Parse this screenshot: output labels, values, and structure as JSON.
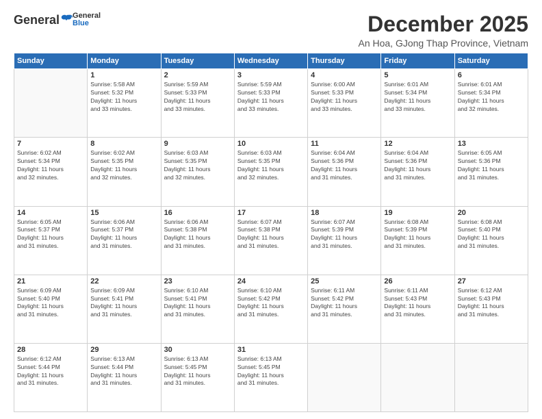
{
  "logo": {
    "general": "General",
    "blue": "Blue"
  },
  "title": "December 2025",
  "location": "An Hoa, GJong Thap Province, Vietnam",
  "weekdays": [
    "Sunday",
    "Monday",
    "Tuesday",
    "Wednesday",
    "Thursday",
    "Friday",
    "Saturday"
  ],
  "weeks": [
    [
      {
        "day": "",
        "info": ""
      },
      {
        "day": "1",
        "info": "Sunrise: 5:58 AM\nSunset: 5:32 PM\nDaylight: 11 hours\nand 33 minutes."
      },
      {
        "day": "2",
        "info": "Sunrise: 5:59 AM\nSunset: 5:33 PM\nDaylight: 11 hours\nand 33 minutes."
      },
      {
        "day": "3",
        "info": "Sunrise: 5:59 AM\nSunset: 5:33 PM\nDaylight: 11 hours\nand 33 minutes."
      },
      {
        "day": "4",
        "info": "Sunrise: 6:00 AM\nSunset: 5:33 PM\nDaylight: 11 hours\nand 33 minutes."
      },
      {
        "day": "5",
        "info": "Sunrise: 6:01 AM\nSunset: 5:34 PM\nDaylight: 11 hours\nand 33 minutes."
      },
      {
        "day": "6",
        "info": "Sunrise: 6:01 AM\nSunset: 5:34 PM\nDaylight: 11 hours\nand 32 minutes."
      }
    ],
    [
      {
        "day": "7",
        "info": "Sunrise: 6:02 AM\nSunset: 5:34 PM\nDaylight: 11 hours\nand 32 minutes."
      },
      {
        "day": "8",
        "info": "Sunrise: 6:02 AM\nSunset: 5:35 PM\nDaylight: 11 hours\nand 32 minutes."
      },
      {
        "day": "9",
        "info": "Sunrise: 6:03 AM\nSunset: 5:35 PM\nDaylight: 11 hours\nand 32 minutes."
      },
      {
        "day": "10",
        "info": "Sunrise: 6:03 AM\nSunset: 5:35 PM\nDaylight: 11 hours\nand 32 minutes."
      },
      {
        "day": "11",
        "info": "Sunrise: 6:04 AM\nSunset: 5:36 PM\nDaylight: 11 hours\nand 31 minutes."
      },
      {
        "day": "12",
        "info": "Sunrise: 6:04 AM\nSunset: 5:36 PM\nDaylight: 11 hours\nand 31 minutes."
      },
      {
        "day": "13",
        "info": "Sunrise: 6:05 AM\nSunset: 5:36 PM\nDaylight: 11 hours\nand 31 minutes."
      }
    ],
    [
      {
        "day": "14",
        "info": "Sunrise: 6:05 AM\nSunset: 5:37 PM\nDaylight: 11 hours\nand 31 minutes."
      },
      {
        "day": "15",
        "info": "Sunrise: 6:06 AM\nSunset: 5:37 PM\nDaylight: 11 hours\nand 31 minutes."
      },
      {
        "day": "16",
        "info": "Sunrise: 6:06 AM\nSunset: 5:38 PM\nDaylight: 11 hours\nand 31 minutes."
      },
      {
        "day": "17",
        "info": "Sunrise: 6:07 AM\nSunset: 5:38 PM\nDaylight: 11 hours\nand 31 minutes."
      },
      {
        "day": "18",
        "info": "Sunrise: 6:07 AM\nSunset: 5:39 PM\nDaylight: 11 hours\nand 31 minutes."
      },
      {
        "day": "19",
        "info": "Sunrise: 6:08 AM\nSunset: 5:39 PM\nDaylight: 11 hours\nand 31 minutes."
      },
      {
        "day": "20",
        "info": "Sunrise: 6:08 AM\nSunset: 5:40 PM\nDaylight: 11 hours\nand 31 minutes."
      }
    ],
    [
      {
        "day": "21",
        "info": "Sunrise: 6:09 AM\nSunset: 5:40 PM\nDaylight: 11 hours\nand 31 minutes."
      },
      {
        "day": "22",
        "info": "Sunrise: 6:09 AM\nSunset: 5:41 PM\nDaylight: 11 hours\nand 31 minutes."
      },
      {
        "day": "23",
        "info": "Sunrise: 6:10 AM\nSunset: 5:41 PM\nDaylight: 11 hours\nand 31 minutes."
      },
      {
        "day": "24",
        "info": "Sunrise: 6:10 AM\nSunset: 5:42 PM\nDaylight: 11 hours\nand 31 minutes."
      },
      {
        "day": "25",
        "info": "Sunrise: 6:11 AM\nSunset: 5:42 PM\nDaylight: 11 hours\nand 31 minutes."
      },
      {
        "day": "26",
        "info": "Sunrise: 6:11 AM\nSunset: 5:43 PM\nDaylight: 11 hours\nand 31 minutes."
      },
      {
        "day": "27",
        "info": "Sunrise: 6:12 AM\nSunset: 5:43 PM\nDaylight: 11 hours\nand 31 minutes."
      }
    ],
    [
      {
        "day": "28",
        "info": "Sunrise: 6:12 AM\nSunset: 5:44 PM\nDaylight: 11 hours\nand 31 minutes."
      },
      {
        "day": "29",
        "info": "Sunrise: 6:13 AM\nSunset: 5:44 PM\nDaylight: 11 hours\nand 31 minutes."
      },
      {
        "day": "30",
        "info": "Sunrise: 6:13 AM\nSunset: 5:45 PM\nDaylight: 11 hours\nand 31 minutes."
      },
      {
        "day": "31",
        "info": "Sunrise: 6:13 AM\nSunset: 5:45 PM\nDaylight: 11 hours\nand 31 minutes."
      },
      {
        "day": "",
        "info": ""
      },
      {
        "day": "",
        "info": ""
      },
      {
        "day": "",
        "info": ""
      }
    ]
  ]
}
